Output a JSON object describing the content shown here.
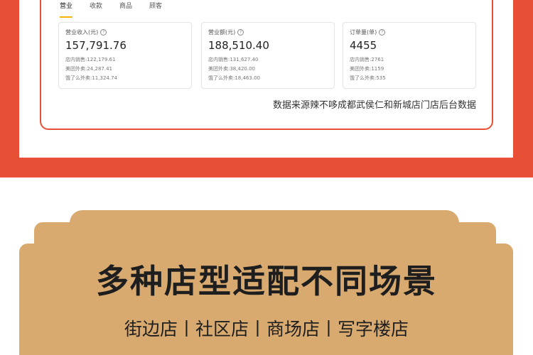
{
  "tabs": [
    "营业",
    "收款",
    "商品",
    "顾客"
  ],
  "cards": [
    {
      "label": "营业收入(元)",
      "value": "157,791.76",
      "details": [
        "店内销售:122,179.61",
        "美团外卖:24,287.41",
        "饿了么外卖:11,324.74"
      ]
    },
    {
      "label": "营业额(元)",
      "value": "188,510.40",
      "details": [
        "店内销售:131,627.40",
        "美团外卖:38,420.00",
        "饿了么外卖:18,463.00"
      ]
    },
    {
      "label": "订单量(单)",
      "value": "4455",
      "details": [
        "店内销售:2761",
        "美团外卖:1159",
        "饿了么外卖:535"
      ]
    }
  ],
  "help_icon": "question-circle-icon",
  "caption": "数据来源辣不哆成都武侯仁和新城店门店后台数据",
  "headline": "多种店型适配不同场景",
  "subline": "街边店丨社区店丨商场店丨写字楼店",
  "colors": {
    "accent_red": "#e94f34",
    "tab_underline": "#f5b400",
    "tan": "#d9aa70"
  }
}
